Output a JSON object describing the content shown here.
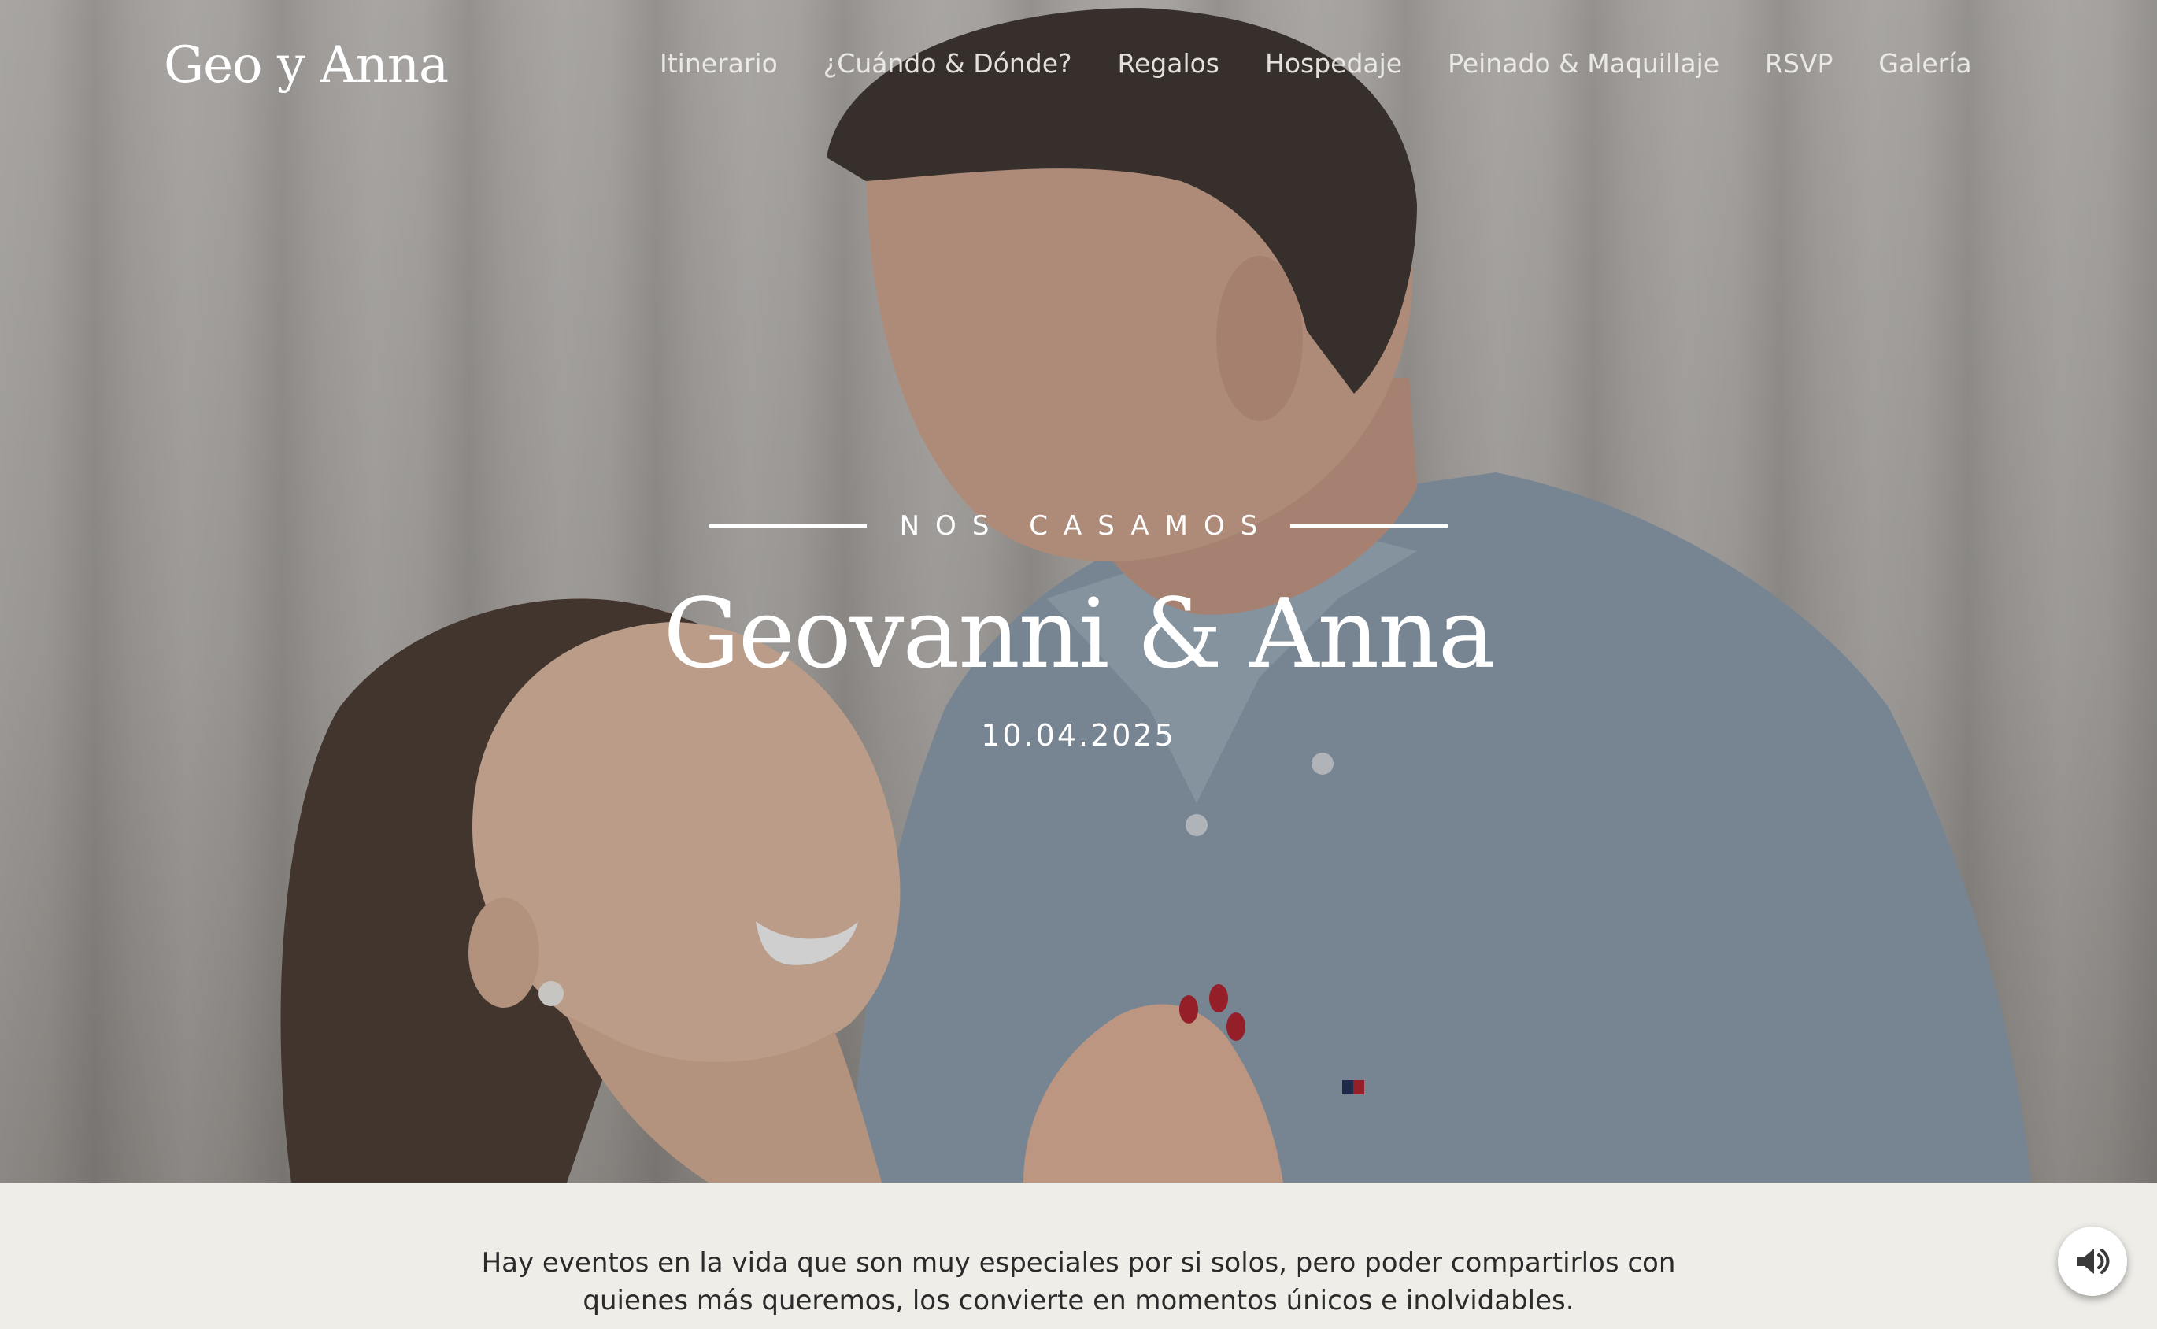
{
  "nav": {
    "logo": "Geo y Anna",
    "items": [
      {
        "label": "Itinerario"
      },
      {
        "label": "¿Cuándo & Dónde?"
      },
      {
        "label": "Regalos"
      },
      {
        "label": "Hospedaje"
      },
      {
        "label": "Peinado & Maquillaje"
      },
      {
        "label": "RSVP"
      },
      {
        "label": "Galería"
      }
    ]
  },
  "hero": {
    "eyebrow": "NOS CASAMOS",
    "title": "Geovanni & Anna",
    "date": "10.04.2025",
    "image": "couple-photo"
  },
  "intro": {
    "line1": "Hay eventos en la vida que son muy especiales por si solos, pero poder compartirlos con",
    "line2": "quienes más queremos, los convierte en momentos únicos e inolvidables."
  },
  "audio_button": {
    "icon": "speaker-icon"
  },
  "colors": {
    "page_bg": "#efede8",
    "hero_text": "#ffffff",
    "body_text": "#2b2b2b",
    "shirt": "#8fa3b4"
  }
}
